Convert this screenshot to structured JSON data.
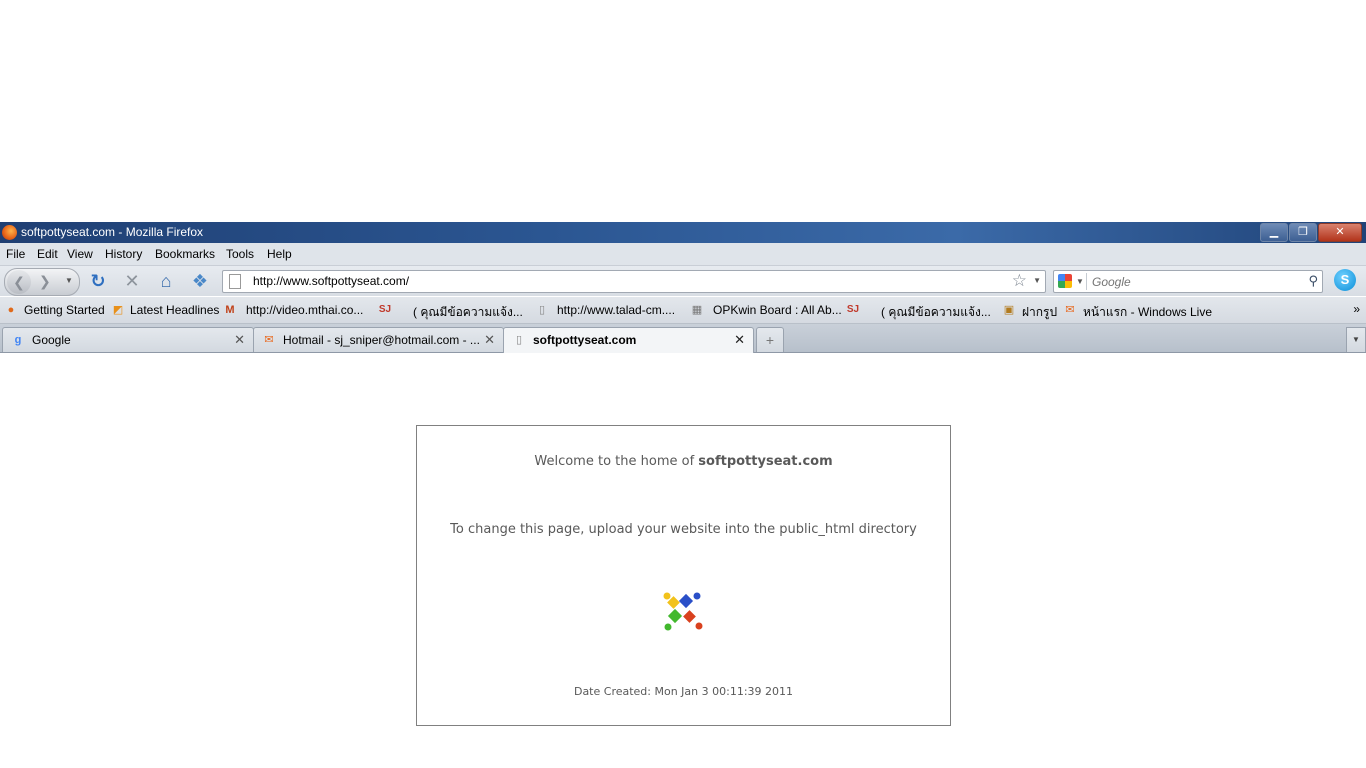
{
  "window": {
    "title": "softpottyseat.com - Mozilla Firefox",
    "controls": [
      "minimize",
      "restore",
      "close"
    ]
  },
  "menu": {
    "items": [
      "File",
      "Edit",
      "View",
      "History",
      "Bookmarks",
      "Tools",
      "Help"
    ]
  },
  "navbar": {
    "url": "http://www.softpottyseat.com/",
    "search_placeholder": "Google"
  },
  "bookmarks": {
    "items": [
      {
        "label": "Getting Started",
        "icon": "firefox-icon"
      },
      {
        "label": "Latest Headlines",
        "icon": "rss-icon"
      },
      {
        "label": "http://video.mthai.co...",
        "icon": "mthai-icon"
      },
      {
        "label": "( คุณมีข้อความแจ้ง...",
        "icon": "sj-icon"
      },
      {
        "label": "http://www.talad-cm....",
        "icon": "page-icon"
      },
      {
        "label": "OPKwin Board : All Ab...",
        "icon": "board-icon"
      },
      {
        "label": "( คุณมีข้อความแจ้ง...",
        "icon": "sj-icon"
      },
      {
        "label": "ฝากรูป",
        "icon": "photo-icon"
      },
      {
        "label": "หน้าแรก - Windows Live",
        "icon": "windows-live-icon"
      }
    ],
    "overflow": "»"
  },
  "tabs": [
    {
      "label": "Google",
      "icon": "google-icon",
      "active": false
    },
    {
      "label": "Hotmail - sj_sniper@hotmail.com - ...",
      "icon": "hotmail-icon",
      "active": false
    },
    {
      "label": "softpottyseat.com",
      "icon": "page-icon",
      "active": true
    }
  ],
  "page": {
    "welcome_prefix": "Welcome to the home of ",
    "domain": "softpottyseat.com",
    "instruction": "To change this page, upload your website into the public_html directory",
    "date_created": "Date Created: Mon Jan 3 00:11:39 2011"
  }
}
